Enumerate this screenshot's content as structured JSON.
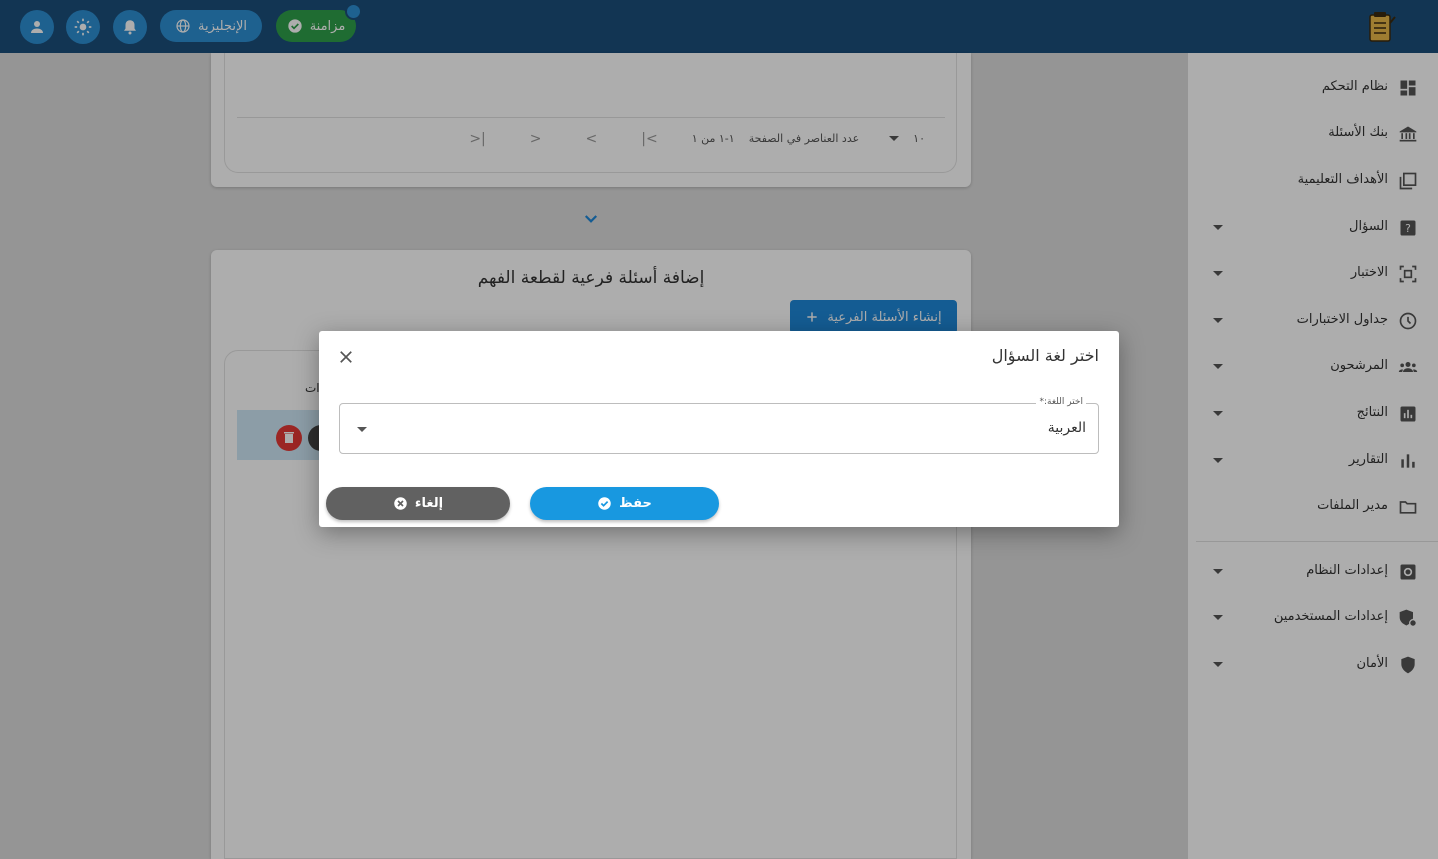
{
  "topbar": {
    "language_label": "الإنجليزية",
    "sync_label": "مزامنة"
  },
  "table_pager": {
    "items_per_page_label": "عدد العناصر في الصفحة",
    "items_per_page_value": "١٠",
    "range_label": "١-١ من ١"
  },
  "subquestions": {
    "title": "إضافة أسئلة فرعية لقطعة الفهم",
    "create_button": "إنشاء الأسئلة الفرعية",
    "column_stub": "ات"
  },
  "sidebar": {
    "items": [
      {
        "label": "نظام التحكم",
        "icon": "dashboard-icon",
        "expandable": false
      },
      {
        "label": "بنك الأسئلة",
        "icon": "bank-icon",
        "expandable": false
      },
      {
        "label": "الأهداف التعليمية",
        "icon": "library-icon",
        "expandable": false
      },
      {
        "label": "السؤال",
        "icon": "question-icon",
        "expandable": true
      },
      {
        "label": "الاختبار",
        "icon": "quiz-frame-icon",
        "expandable": true
      },
      {
        "label": "جداول الاختبارات",
        "icon": "clock-icon",
        "expandable": true
      },
      {
        "label": "المرشحون",
        "icon": "people-icon",
        "expandable": true
      },
      {
        "label": "النتائج",
        "icon": "bar-chart-box-icon",
        "expandable": true
      },
      {
        "label": "التقارير",
        "icon": "bar-chart-icon",
        "expandable": true
      },
      {
        "label": "مدير الملفات",
        "icon": "folder-icon",
        "expandable": false
      },
      {
        "label": "إعدادات النظام",
        "icon": "settings-box-icon",
        "expandable": true
      },
      {
        "label": "إعدادات المستخدمين",
        "icon": "user-shield-icon",
        "expandable": true
      },
      {
        "label": "الأمان",
        "icon": "shield-icon",
        "expandable": true
      }
    ]
  },
  "dialog": {
    "title": "اختر لغة السؤال",
    "field_label": "اختر اللغة:*",
    "field_value": "العربية",
    "save_label": "حفظ",
    "cancel_label": "إلغاء"
  },
  "colors": {
    "topbar": "#1b4f7b",
    "primary": "#1898e0",
    "sync_green": "#2ea04a",
    "cancel_gray": "#616161",
    "danger": "#e53935"
  }
}
